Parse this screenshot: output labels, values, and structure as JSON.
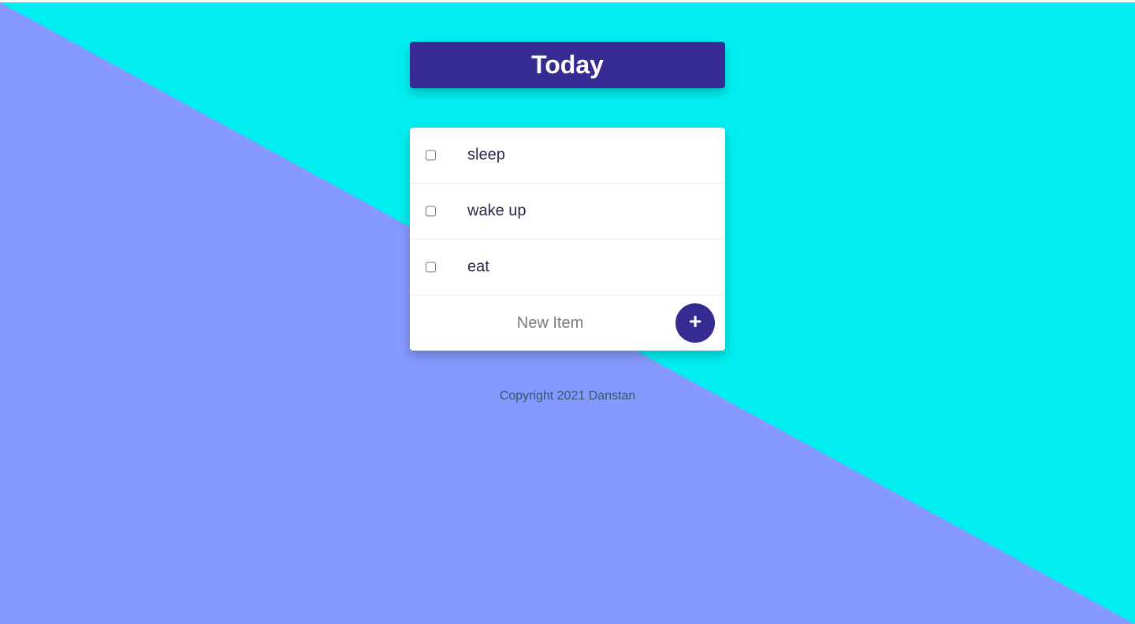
{
  "header": {
    "title": "Today"
  },
  "list": {
    "items": [
      {
        "label": "sleep",
        "checked": false
      },
      {
        "label": "wake up",
        "checked": false
      },
      {
        "label": "eat",
        "checked": false
      }
    ],
    "new_item": {
      "placeholder": "New Item",
      "value": "",
      "add_label": "+"
    }
  },
  "footer": {
    "text": "Copyright 2021 Danstan"
  },
  "colors": {
    "accent": "#372a93",
    "background_left": "#8599ff",
    "background_right": "#00eef0"
  }
}
